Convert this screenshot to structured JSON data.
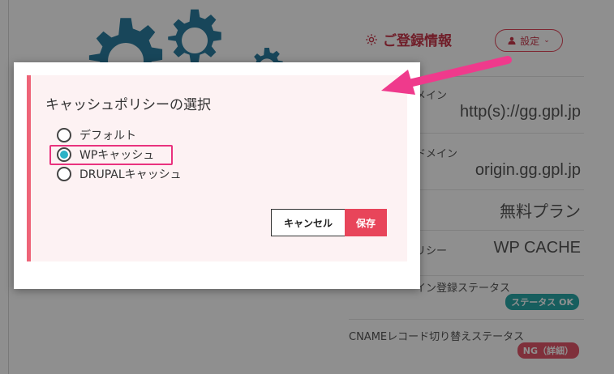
{
  "background": {
    "info_title": "ご登録情報",
    "settings_label": "設定",
    "rows": [
      {
        "label": "メイン",
        "value": "http(s)://gg.gpl.jp"
      },
      {
        "label": "ドメイン",
        "value": "origin.gg.gpl.jp"
      },
      {
        "label": "",
        "value": "無料プラン"
      },
      {
        "label": "リシー",
        "value": "WP CACHE"
      },
      {
        "label": "イン登録ステータス",
        "badge": "ステータス OK"
      },
      {
        "label": "CNAMEレコード切り替えステータス",
        "badge": "NG（詳細）"
      }
    ]
  },
  "modal": {
    "title": "キャッシュポリシーの選択",
    "options": [
      {
        "label": "デフォルト",
        "checked": false
      },
      {
        "label": "WPキャッシュ",
        "checked": true
      },
      {
        "label": "DRUPALキャッシュ",
        "checked": false
      }
    ],
    "cancel_label": "キャンセル",
    "save_label": "保存"
  },
  "colors": {
    "accent": "#e8455a",
    "panel_bg": "#fdf2f3",
    "radio_selected": "#2ab2c6",
    "highlight": "#e9327e",
    "arrow": "#ef3a8c",
    "gear": "#2b7ea0"
  },
  "icons": [
    "gear-icon",
    "user-icon",
    "chevron-down-icon",
    "arrow-annotation"
  ]
}
